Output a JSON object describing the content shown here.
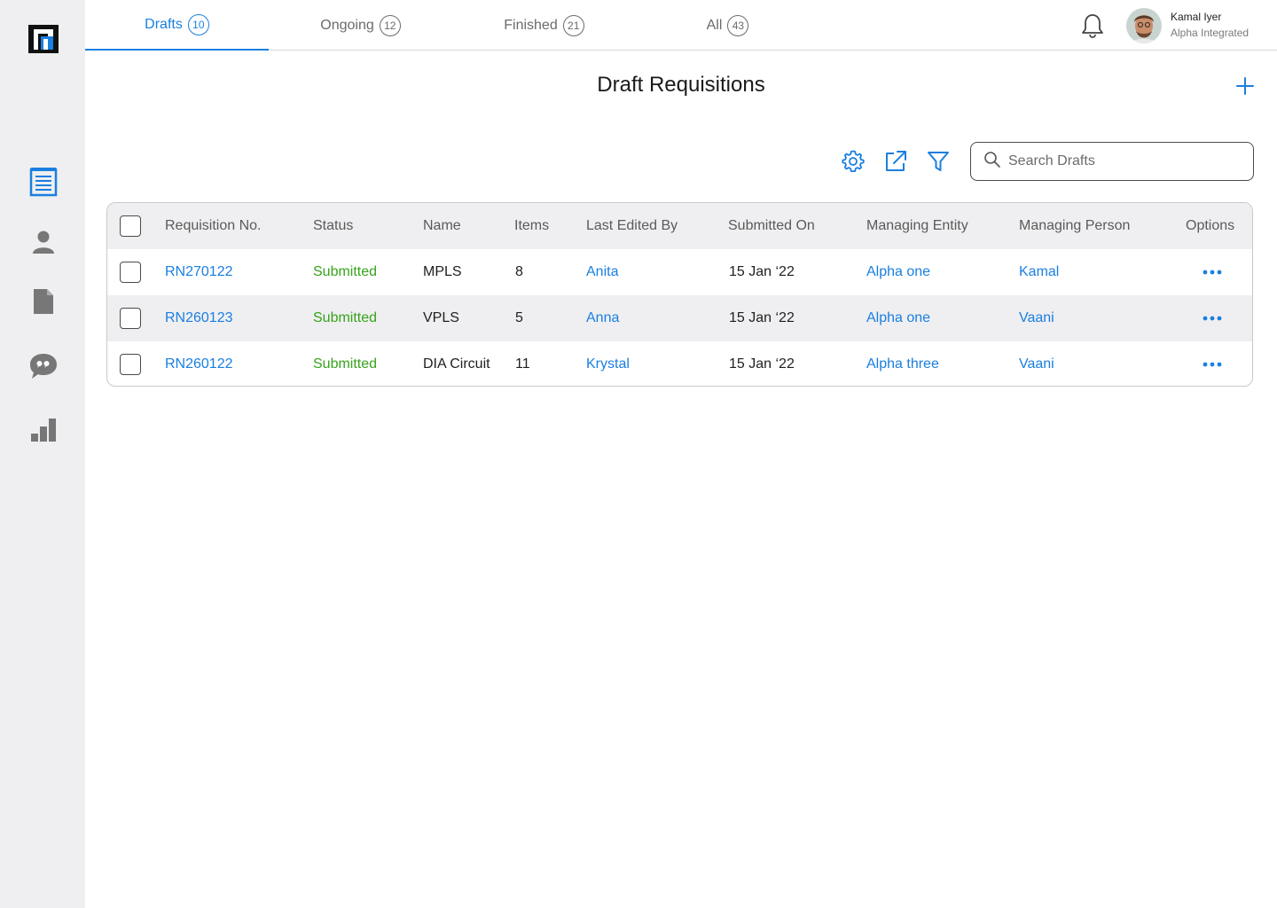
{
  "tabs": [
    {
      "label": "Drafts",
      "count": "10"
    },
    {
      "label": "Ongoing",
      "count": "12"
    },
    {
      "label": "Finished",
      "count": "21"
    },
    {
      "label": "All",
      "count": "43"
    }
  ],
  "user": {
    "name": "Kamal Iyer",
    "org": "Alpha Integrated"
  },
  "page": {
    "title": "Draft Requisitions"
  },
  "search": {
    "placeholder": "Search Drafts"
  },
  "colors": {
    "accent": "#1a7fe0",
    "success": "#36a31a",
    "sidebar": "#efeff1"
  },
  "sidebar": {
    "items": [
      "requisitions-icon",
      "user-icon",
      "document-icon",
      "chat-quote-icon",
      "bar-chart-icon"
    ]
  },
  "table": {
    "columns": [
      "Requisition No.",
      "Status",
      "Name",
      "Items",
      "Last Edited By",
      "Submitted On",
      "Managing Entity",
      "Managing Person",
      "Options"
    ],
    "rows": [
      {
        "req": "RN270122",
        "status": "Submitted",
        "name": "MPLS",
        "items": "8",
        "editor": "Anita",
        "date": "15 Jan ‘22",
        "entity": "Alpha one",
        "person": "Kamal"
      },
      {
        "req": "RN260123",
        "status": "Submitted",
        "name": "VPLS",
        "items": "5",
        "editor": "Anna",
        "date": "15 Jan ‘22",
        "entity": "Alpha one",
        "person": "Vaani"
      },
      {
        "req": "RN260122",
        "status": "Submitted",
        "name": "DIA Circuit",
        "items": "11",
        "editor": "Krystal",
        "date": "15 Jan ‘22",
        "entity": "Alpha three",
        "person": "Vaani"
      }
    ]
  }
}
